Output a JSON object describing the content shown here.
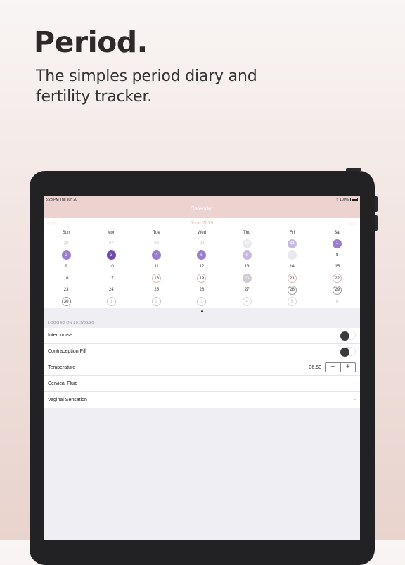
{
  "marketing": {
    "headline": "Period.",
    "subline": "The simples period diary and fertility tracker."
  },
  "status_bar": {
    "time_date": "5:28 PM  Thu Jun 20",
    "battery": "100%"
  },
  "nav": {
    "title": "Calendar",
    "prev": "Prev",
    "next": "Next"
  },
  "calendar": {
    "month_label": "June 2019",
    "weekdays": [
      "Sun",
      "Mon",
      "Tue",
      "Wed",
      "Thu",
      "Fri",
      "Sat"
    ],
    "weeks": [
      [
        {
          "d": "26",
          "s": "other"
        },
        {
          "d": "27",
          "s": "other"
        },
        {
          "d": "28",
          "s": "other"
        },
        {
          "d": "29",
          "s": "other"
        },
        {
          "d": "30",
          "s": "faint"
        },
        {
          "d": "31",
          "s": "pred"
        },
        {
          "d": "1",
          "s": "period"
        }
      ],
      [
        {
          "d": "2",
          "s": "period"
        },
        {
          "d": "3",
          "s": "today"
        },
        {
          "d": "4",
          "s": "period"
        },
        {
          "d": "5",
          "s": "period"
        },
        {
          "d": "6",
          "s": "pred"
        },
        {
          "d": "7",
          "s": "faint"
        },
        {
          "d": "8",
          "s": "normal"
        }
      ],
      [
        {
          "d": "9",
          "s": "normal"
        },
        {
          "d": "10",
          "s": "normal"
        },
        {
          "d": "11",
          "s": "normal"
        },
        {
          "d": "12",
          "s": "normal"
        },
        {
          "d": "13",
          "s": "normal"
        },
        {
          "d": "14",
          "s": "normal"
        },
        {
          "d": "15",
          "s": "normal"
        }
      ],
      [
        {
          "d": "16",
          "s": "normal"
        },
        {
          "d": "17",
          "s": "normal"
        },
        {
          "d": "18",
          "s": "fertile"
        },
        {
          "d": "19",
          "s": "fertile"
        },
        {
          "d": "20",
          "s": "sel"
        },
        {
          "d": "21",
          "s": "fertile"
        },
        {
          "d": "22",
          "s": "fertile"
        }
      ],
      [
        {
          "d": "23",
          "s": "normal"
        },
        {
          "d": "24",
          "s": "normal"
        },
        {
          "d": "25",
          "s": "normal"
        },
        {
          "d": "26",
          "s": "normal"
        },
        {
          "d": "27",
          "s": "normal"
        },
        {
          "d": "28",
          "s": "fertile-gray"
        },
        {
          "d": "29",
          "s": "fertile-gray"
        }
      ],
      [
        {
          "d": "30",
          "s": "fertile-gray"
        },
        {
          "d": "1",
          "s": "fertile-faint"
        },
        {
          "d": "2",
          "s": "fertile-faint"
        },
        {
          "d": "3",
          "s": "fertile-faint"
        },
        {
          "d": "4",
          "s": "fertile-pale"
        },
        {
          "d": "5",
          "s": "fertile-pale"
        },
        {
          "d": "6",
          "s": "other"
        }
      ]
    ]
  },
  "log": {
    "section_title": "LOGGED ON 2019/06/20",
    "intercourse": {
      "label": "Intercourse"
    },
    "pill": {
      "label": "Contraception Pill"
    },
    "temperature": {
      "label": "Temperature",
      "value": "36.50",
      "minus": "−",
      "plus": "+"
    },
    "fluid": {
      "label": "Cervical Fluid",
      "value": "-"
    },
    "sensation": {
      "label": "Vaginal Sensation",
      "value": "-"
    }
  },
  "colors": {
    "period": "#9b7dcd",
    "today": "#6a4ea9",
    "predicted": "#c8b9e4",
    "fertile_ring": "#e3b6b1",
    "header_bg": "#ecd3cf"
  }
}
